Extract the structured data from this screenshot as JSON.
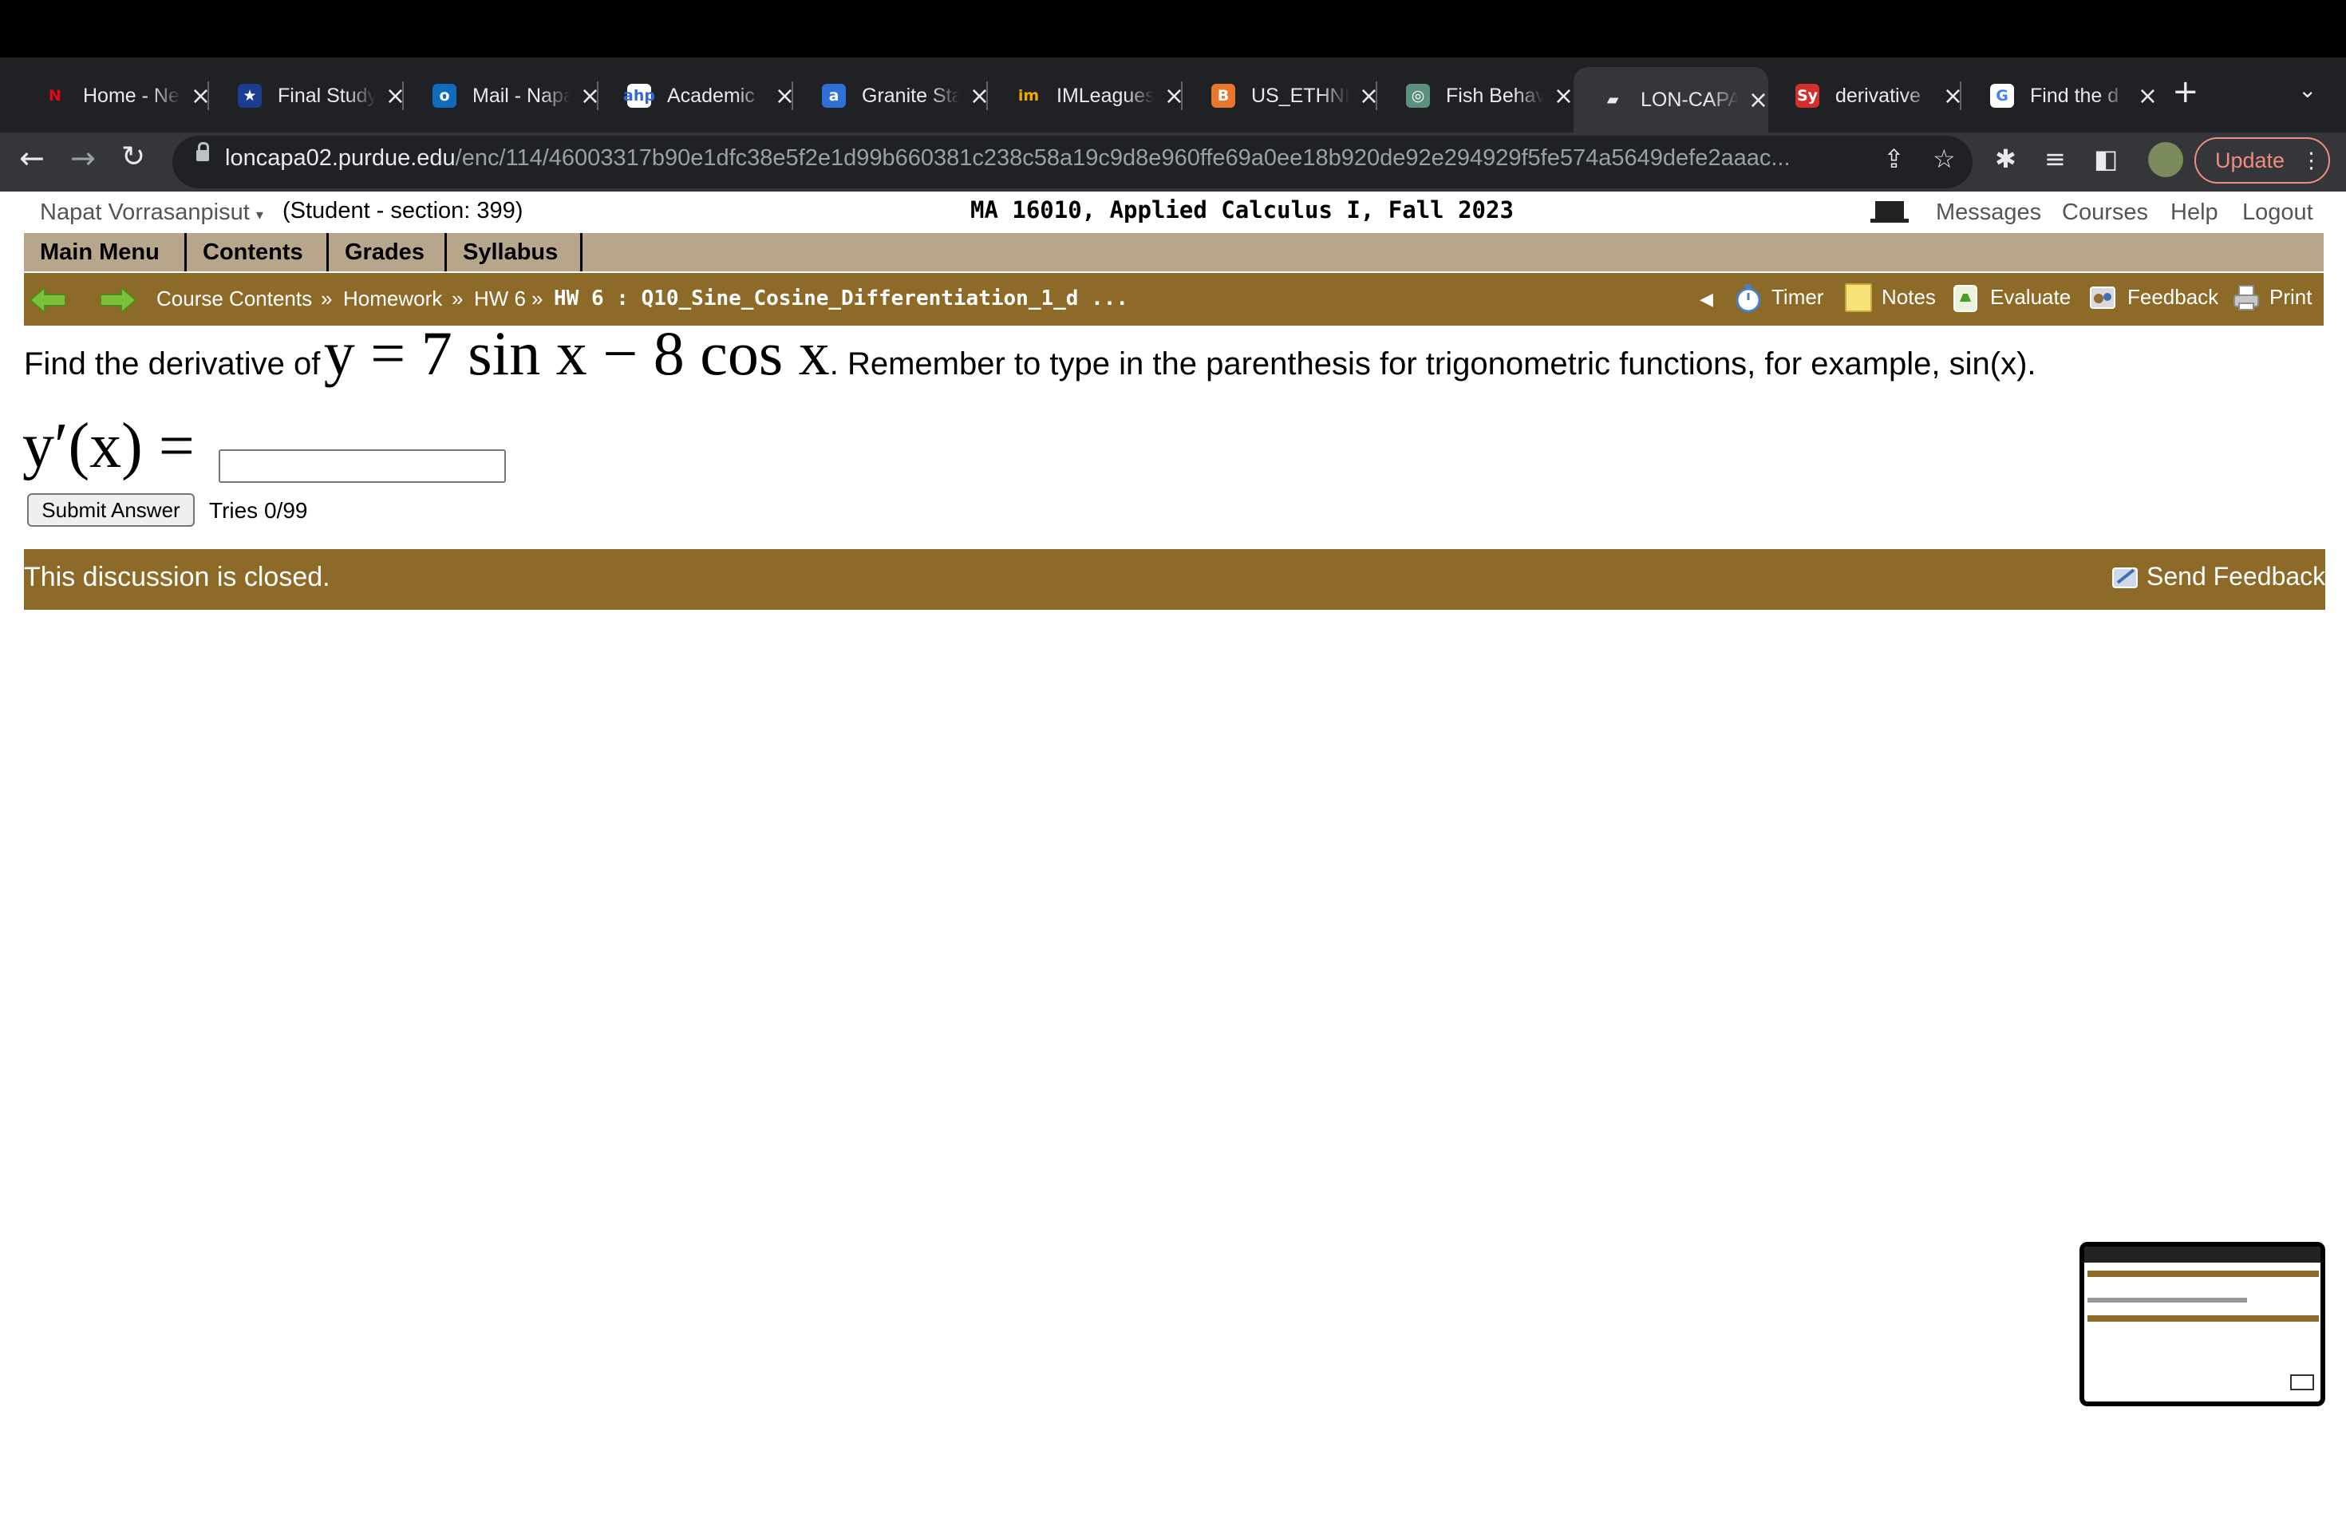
{
  "browser": {
    "tabs": [
      {
        "title": "Home - Netflix",
        "favicon": "N",
        "favicon_color": "#e50914",
        "favicon_bg": "transparent",
        "active": false
      },
      {
        "title": "Final Study",
        "favicon": "★",
        "favicon_color": "#ffffff",
        "favicon_bg": "#1a3d8f",
        "active": false
      },
      {
        "title": "Mail - Napat",
        "favicon": "o",
        "favicon_color": "#ffffff",
        "favicon_bg": "#0f6cbd",
        "active": false
      },
      {
        "title": "Academic",
        "favicon": "ahp",
        "favicon_color": "#3367d6",
        "favicon_bg": "#ffffff",
        "active": false
      },
      {
        "title": "Granite State",
        "favicon": "a",
        "favicon_color": "#ffffff",
        "favicon_bg": "#2f6fd6",
        "active": false
      },
      {
        "title": "IMLeagues",
        "favicon": "im",
        "favicon_color": "#f2a900",
        "favicon_bg": "transparent",
        "active": false
      },
      {
        "title": "US_ETHNIC",
        "favicon": "B",
        "favicon_color": "#ffffff",
        "favicon_bg": "#e8762b",
        "active": false
      },
      {
        "title": "Fish Behavior",
        "favicon": "◎",
        "favicon_color": "#ffffff",
        "favicon_bg": "#5b8f7e",
        "active": false
      },
      {
        "title": "LON-CAPA",
        "favicon": "▰",
        "favicon_color": "#e8eaed",
        "favicon_bg": "transparent",
        "active": true
      },
      {
        "title": "derivative",
        "favicon": "Sy",
        "favicon_color": "#ffffff",
        "favicon_bg": "#d32f2f",
        "active": false
      },
      {
        "title": "Find the d",
        "favicon": "G",
        "favicon_color": "#4285f4",
        "favicon_bg": "#ffffff",
        "active": false
      }
    ],
    "new_tab_icon": "+",
    "url_host": "loncapa02.purdue.edu",
    "url_path": "/enc/114/46003317b90e1dfc38e5f2e1d99b660381c238c58a19c9d8e960ffe69a0ee18b920de92e294929f5fe574a5649defe2aaac...",
    "update_label": "Update",
    "update_color": "#f28b82"
  },
  "header": {
    "user_name": "Napat Vorrasanpisut",
    "caret": "▾",
    "section_info": "(Student  - section: 399)",
    "course_title": "MA 16010, Applied Calculus I, Fall 2023",
    "links": [
      "Messages",
      "Courses",
      "Help",
      "Logout"
    ]
  },
  "menu": {
    "items": [
      "Main Menu",
      "Contents",
      "Grades",
      "Syllabus"
    ],
    "bg_color": "#b8a68c"
  },
  "breadcrumb": {
    "items": [
      "Course Contents",
      "Homework",
      "HW 6"
    ],
    "separator": "»",
    "current": "HW 6 : Q10_Sine_Cosine_Differentiation_1_d ...",
    "bar_color": "#8d6a28"
  },
  "tools": {
    "collapse": "◀",
    "timer": "Timer",
    "notes": "Notes",
    "evaluate": "Evaluate",
    "feedback": "Feedback",
    "print": "Print"
  },
  "problem": {
    "prompt_start": "Find the derivative of",
    "equation": "y = 7 sin x − 8 cos x",
    "prompt_end": ". Remember to type in the parenthesis for trigonometric functions, for example, sin(x).",
    "answer_label": "y′(x) =",
    "answer_value": "",
    "submit_label": "Submit Answer",
    "tries": "Tries 0/99"
  },
  "discussion": {
    "status": "This discussion is closed.",
    "send_feedback": "Send Feedback"
  }
}
